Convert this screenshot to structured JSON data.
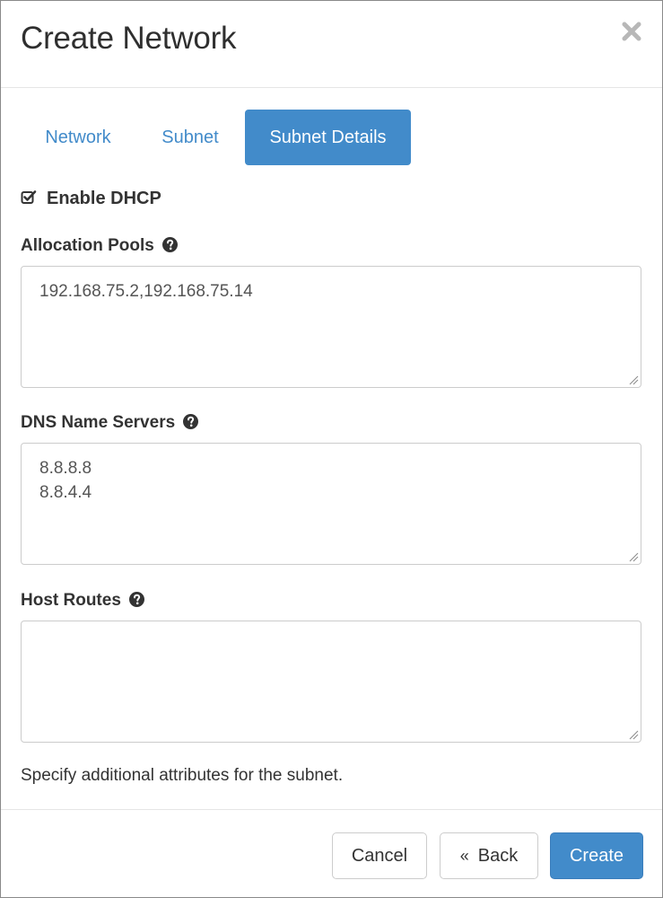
{
  "dialog": {
    "title": "Create Network",
    "close_icon": "close-icon"
  },
  "tabs": [
    {
      "label": "Network",
      "active": false
    },
    {
      "label": "Subnet",
      "active": false
    },
    {
      "label": "Subnet Details",
      "active": true
    }
  ],
  "form": {
    "dhcp": {
      "label": "Enable DHCP",
      "checked": true
    },
    "allocation_pools": {
      "label": "Allocation Pools",
      "value_lines": [
        "192.168.75.2,192.168.75.14"
      ]
    },
    "dns_name_servers": {
      "label": "DNS Name Servers",
      "value_lines": [
        "8.8.8.8",
        "8.8.4.4"
      ]
    },
    "host_routes": {
      "label": "Host Routes",
      "value_lines": []
    },
    "help_text": "Specify additional attributes for the subnet."
  },
  "footer": {
    "cancel_label": "Cancel",
    "back_chevron": "«",
    "back_label": "Back",
    "create_label": "Create"
  },
  "colors": {
    "primary": "#428bca",
    "link": "#428bca",
    "text": "#333333",
    "border": "#cccccc"
  }
}
